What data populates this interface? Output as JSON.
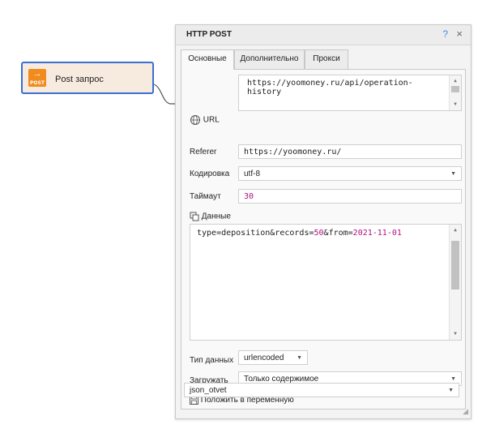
{
  "node": {
    "title": "Post запрос",
    "icon_label": "POST",
    "icon_arrow": "→",
    "accent": "#f18b1e",
    "border": "#3b6fd1"
  },
  "panel": {
    "title": "HTTP POST",
    "help": "?",
    "close": "×",
    "tabs": [
      {
        "label": "Основные"
      },
      {
        "label": "Дополнительно"
      },
      {
        "label": "Прокси"
      }
    ],
    "url": {
      "label": "URL",
      "value_line1": "https://yoomoney.ru/api/operation-",
      "value_line2": "history"
    },
    "referer": {
      "label": "Referer",
      "value": "https://yoomoney.ru/"
    },
    "encoding": {
      "label": "Кодировка",
      "value": "utf-8"
    },
    "timeout": {
      "label": "Таймаут",
      "value": "30"
    },
    "data": {
      "label": "Данные",
      "parts": [
        {
          "text": "type=deposition&records=",
          "color": "#222222"
        },
        {
          "text": "50",
          "color": "#b01080"
        },
        {
          "text": "&from=",
          "color": "#222222"
        },
        {
          "text": "2021-11-01",
          "color": "#b01080"
        }
      ]
    },
    "data_type": {
      "label": "Тип данных",
      "value": "urlencoded"
    },
    "load": {
      "label": "Загружать",
      "value": "Только содержимое"
    },
    "save": {
      "label": "Положить в переменную",
      "value": "json_otvet"
    }
  }
}
